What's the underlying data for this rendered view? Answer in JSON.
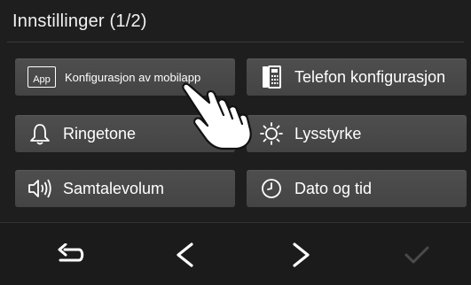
{
  "header": {
    "title": "Innstillinger (1/2)"
  },
  "menu": {
    "items": [
      {
        "label": "Konfigurasjon av mobilapp",
        "icon": "app-icon",
        "badge": "App"
      },
      {
        "label": "Telefon konfigurasjon",
        "icon": "phone-config-icon"
      },
      {
        "label": "Ringetone",
        "icon": "bell-icon"
      },
      {
        "label": "Lysstyrke",
        "icon": "brightness-icon"
      },
      {
        "label": "Samtalevolum",
        "icon": "speaker-volume-icon"
      },
      {
        "label": "Dato og tid",
        "icon": "clock-icon"
      }
    ]
  },
  "nav": {
    "back": {
      "icon": "return-arrow-icon"
    },
    "prev": {
      "icon": "chevron-left-icon"
    },
    "next": {
      "icon": "chevron-right-icon"
    },
    "confirm": {
      "icon": "checkmark-icon",
      "enabled": false
    }
  },
  "colors": {
    "background": "#1e1e1e",
    "button": "#4a4a4a",
    "text": "#ffffff",
    "disabled": "#4a4a4a"
  }
}
